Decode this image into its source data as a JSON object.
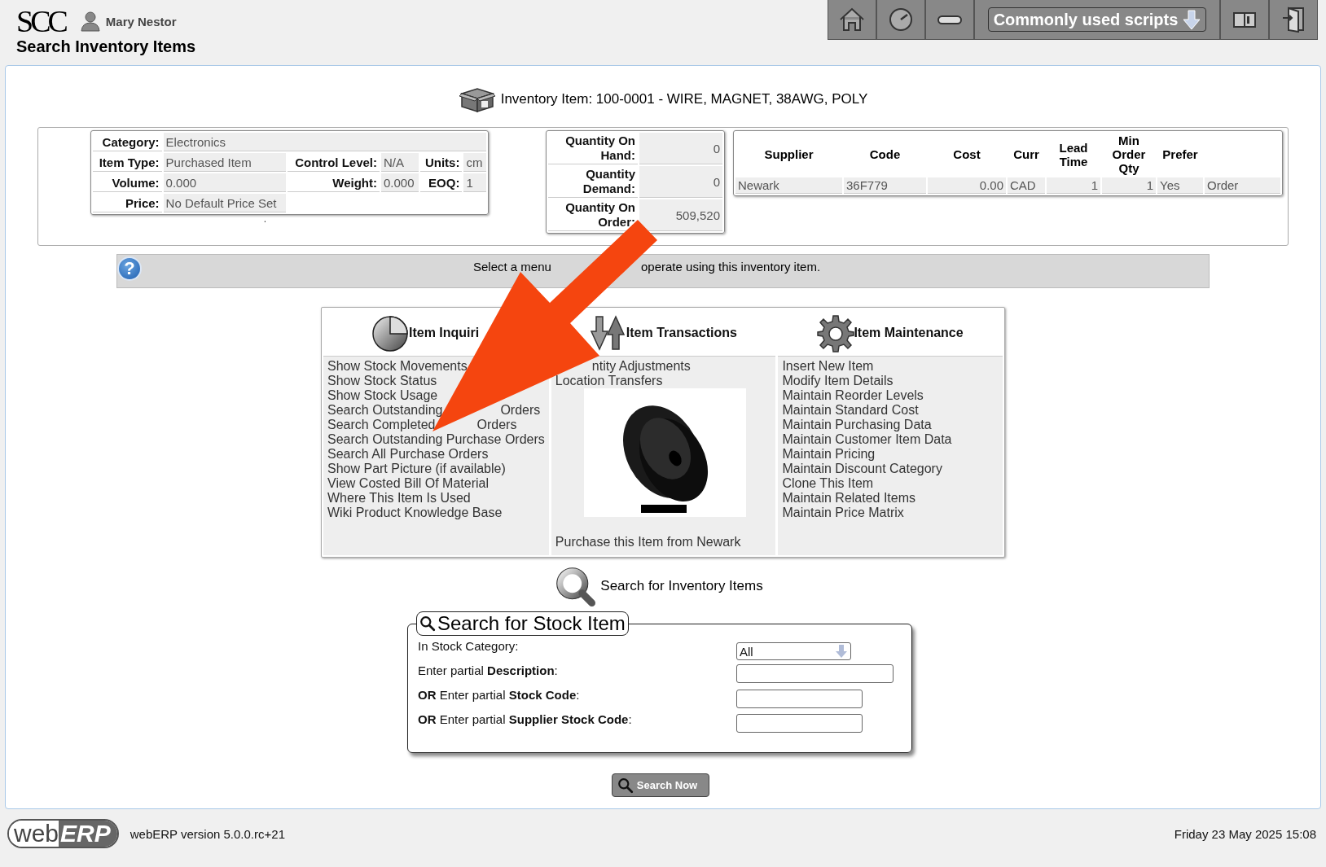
{
  "header": {
    "logo": "SCC",
    "user": "Mary Nestor",
    "page_title": "Search Inventory Items",
    "scripts_menu": "Commonly used scripts"
  },
  "item_title": "Inventory Item: 100-0001 - WIRE, MAGNET, 38AWG, POLY",
  "details": [
    [
      {
        "label": "Category:",
        "value": "Electronics"
      }
    ],
    [
      {
        "label": "Item Type:",
        "value": "Purchased Item"
      },
      {
        "label": "Control Level:",
        "value": "N/A"
      },
      {
        "label": "Units:",
        "value": "cm"
      }
    ],
    [
      {
        "label": "Volume:",
        "value": "0.000"
      },
      {
        "label": "Weight:",
        "value": "0.000"
      },
      {
        "label": "EOQ:",
        "value": "1"
      }
    ],
    [
      {
        "label": "Price:",
        "value": "No Default Price Set"
      }
    ]
  ],
  "details_note": ".",
  "quantities": [
    {
      "label": "Quantity On Hand:",
      "value": "0"
    },
    {
      "label": "Quantity Demand:",
      "value": "0"
    },
    {
      "label": "Quantity On Order:",
      "value": "509,520"
    }
  ],
  "suppliers": {
    "columns": [
      "Supplier",
      "Code",
      "Cost",
      "Curr",
      "Lead Time",
      "Min Order Qty",
      "Prefer"
    ],
    "rows": [
      [
        "Newark",
        "36F779",
        "0.00",
        "CAD",
        "1",
        "1",
        "Yes",
        "Order"
      ]
    ]
  },
  "help": {
    "icon": "?",
    "message": [
      "Select a menu",
      "operate using this inventory item."
    ]
  },
  "menus": [
    {
      "title": "Item Inquiri",
      "items": [
        "Show Stock Movements",
        "Show Stock Status",
        "Show Stock Usage",
        [
          "Search Outstanding",
          "Orders"
        ],
        [
          "Search Completed",
          "Orders"
        ],
        "Search Outstanding Purchase Orders",
        "Search All Purchase Orders",
        "Show Part Picture (if available)",
        "View Costed Bill Of Material",
        "Where This Item Is Used",
        "Wiki Product Knowledge Base"
      ]
    },
    {
      "title": "Item Transactions",
      "items": [
        [
          "ntity Adjustments"
        ],
        "Location Transfers"
      ],
      "picture": {
        "kind": "picture"
      },
      "footer_link": "Purchase this Item from Newark"
    },
    {
      "title": "Item Maintenance",
      "items": [
        "Insert New Item",
        "Modify Item Details",
        "Maintain Reorder Levels",
        "Maintain Standard Cost",
        "Maintain Purchasing Data",
        "Maintain Customer Item Data",
        "Maintain Pricing",
        "Maintain Discount Category",
        "Clone This Item",
        "Maintain Related Items",
        "Maintain Price Matrix"
      ]
    }
  ],
  "search": {
    "heading": "Search for Inventory Items",
    "legend": "Search for Stock Item",
    "fields": [
      {
        "kind": "select",
        "label": "In Stock Category:",
        "value": "All"
      },
      {
        "kind": "text",
        "label": "Enter partial **Description**:"
      },
      {
        "kind": "text",
        "label": "**OR** Enter partial **Stock Code**:"
      },
      {
        "kind": "text",
        "label": "**OR** Enter partial **Supplier Stock Code**:"
      }
    ],
    "button": "Search Now"
  },
  "footer": {
    "logo_left": "web",
    "logo_right": "ERP",
    "version": "webERP version 5.0.0.rc+21",
    "datetime": "Friday 23 May 2025 15:08"
  }
}
